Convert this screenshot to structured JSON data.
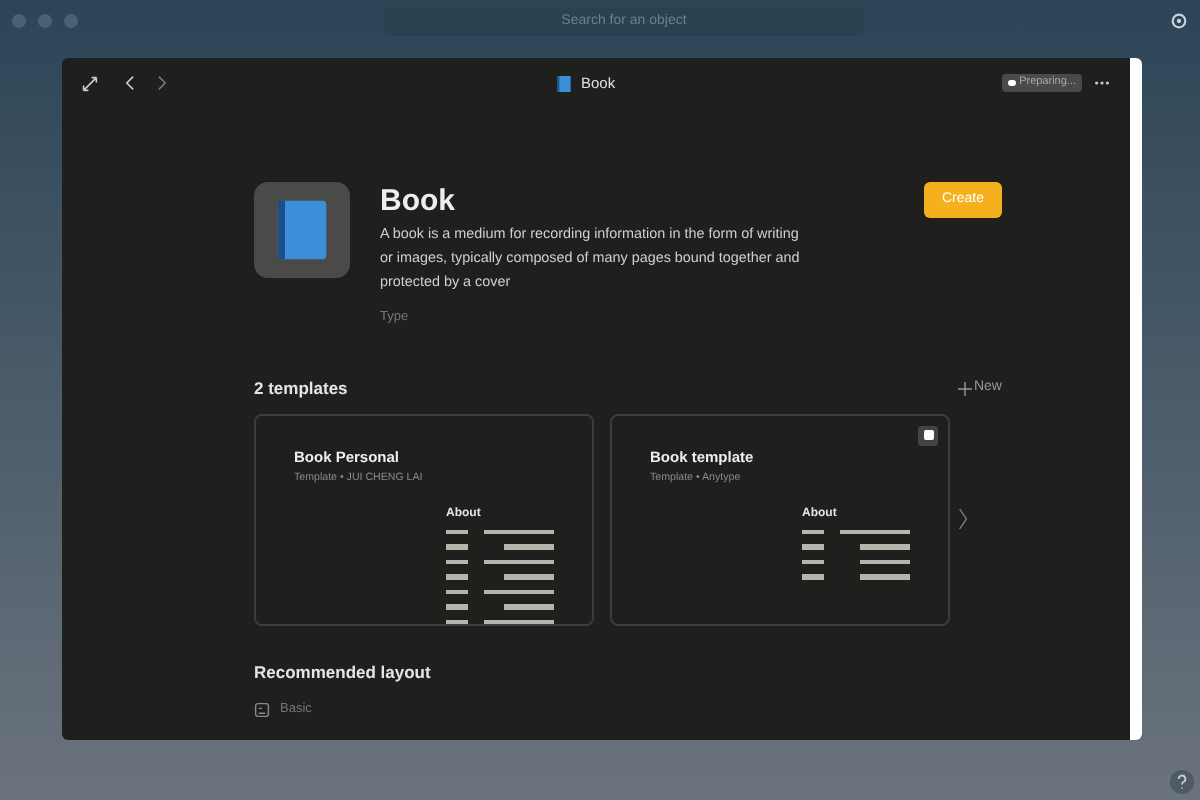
{
  "top_bar": {
    "search": {
      "placeholder": "Search for an object"
    }
  },
  "window": {
    "title": "Book",
    "status": "Preparing..."
  },
  "type": {
    "name": "Book",
    "description": "A book is a medium for recording information in the form of writing or images, typically composed of many pages bound together and protected by a cover",
    "label": "Type",
    "create_button": "Create"
  },
  "templates": {
    "heading": "2 templates",
    "new_button": "New",
    "items": [
      {
        "name": "Book Personal",
        "meta": "Template • JUI CHENG LAI",
        "default_mark": false,
        "preview": {
          "heading": "About",
          "rows": [
            {
              "kind": "long"
            },
            {
              "kind": "short"
            },
            {
              "kind": "long"
            },
            {
              "kind": "short"
            },
            {
              "kind": "long"
            },
            {
              "kind": "short"
            },
            {
              "kind": "long"
            }
          ]
        }
      },
      {
        "name": "Book template",
        "meta": "Template • Anytype",
        "default_mark": true,
        "preview": {
          "heading": "About",
          "rows": [
            {
              "kind": "long"
            },
            {
              "kind": "short"
            },
            {
              "kind": "short"
            },
            {
              "kind": "short"
            }
          ]
        }
      }
    ]
  },
  "recommended_layout": {
    "heading": "Recommended layout",
    "value": "Basic"
  }
}
